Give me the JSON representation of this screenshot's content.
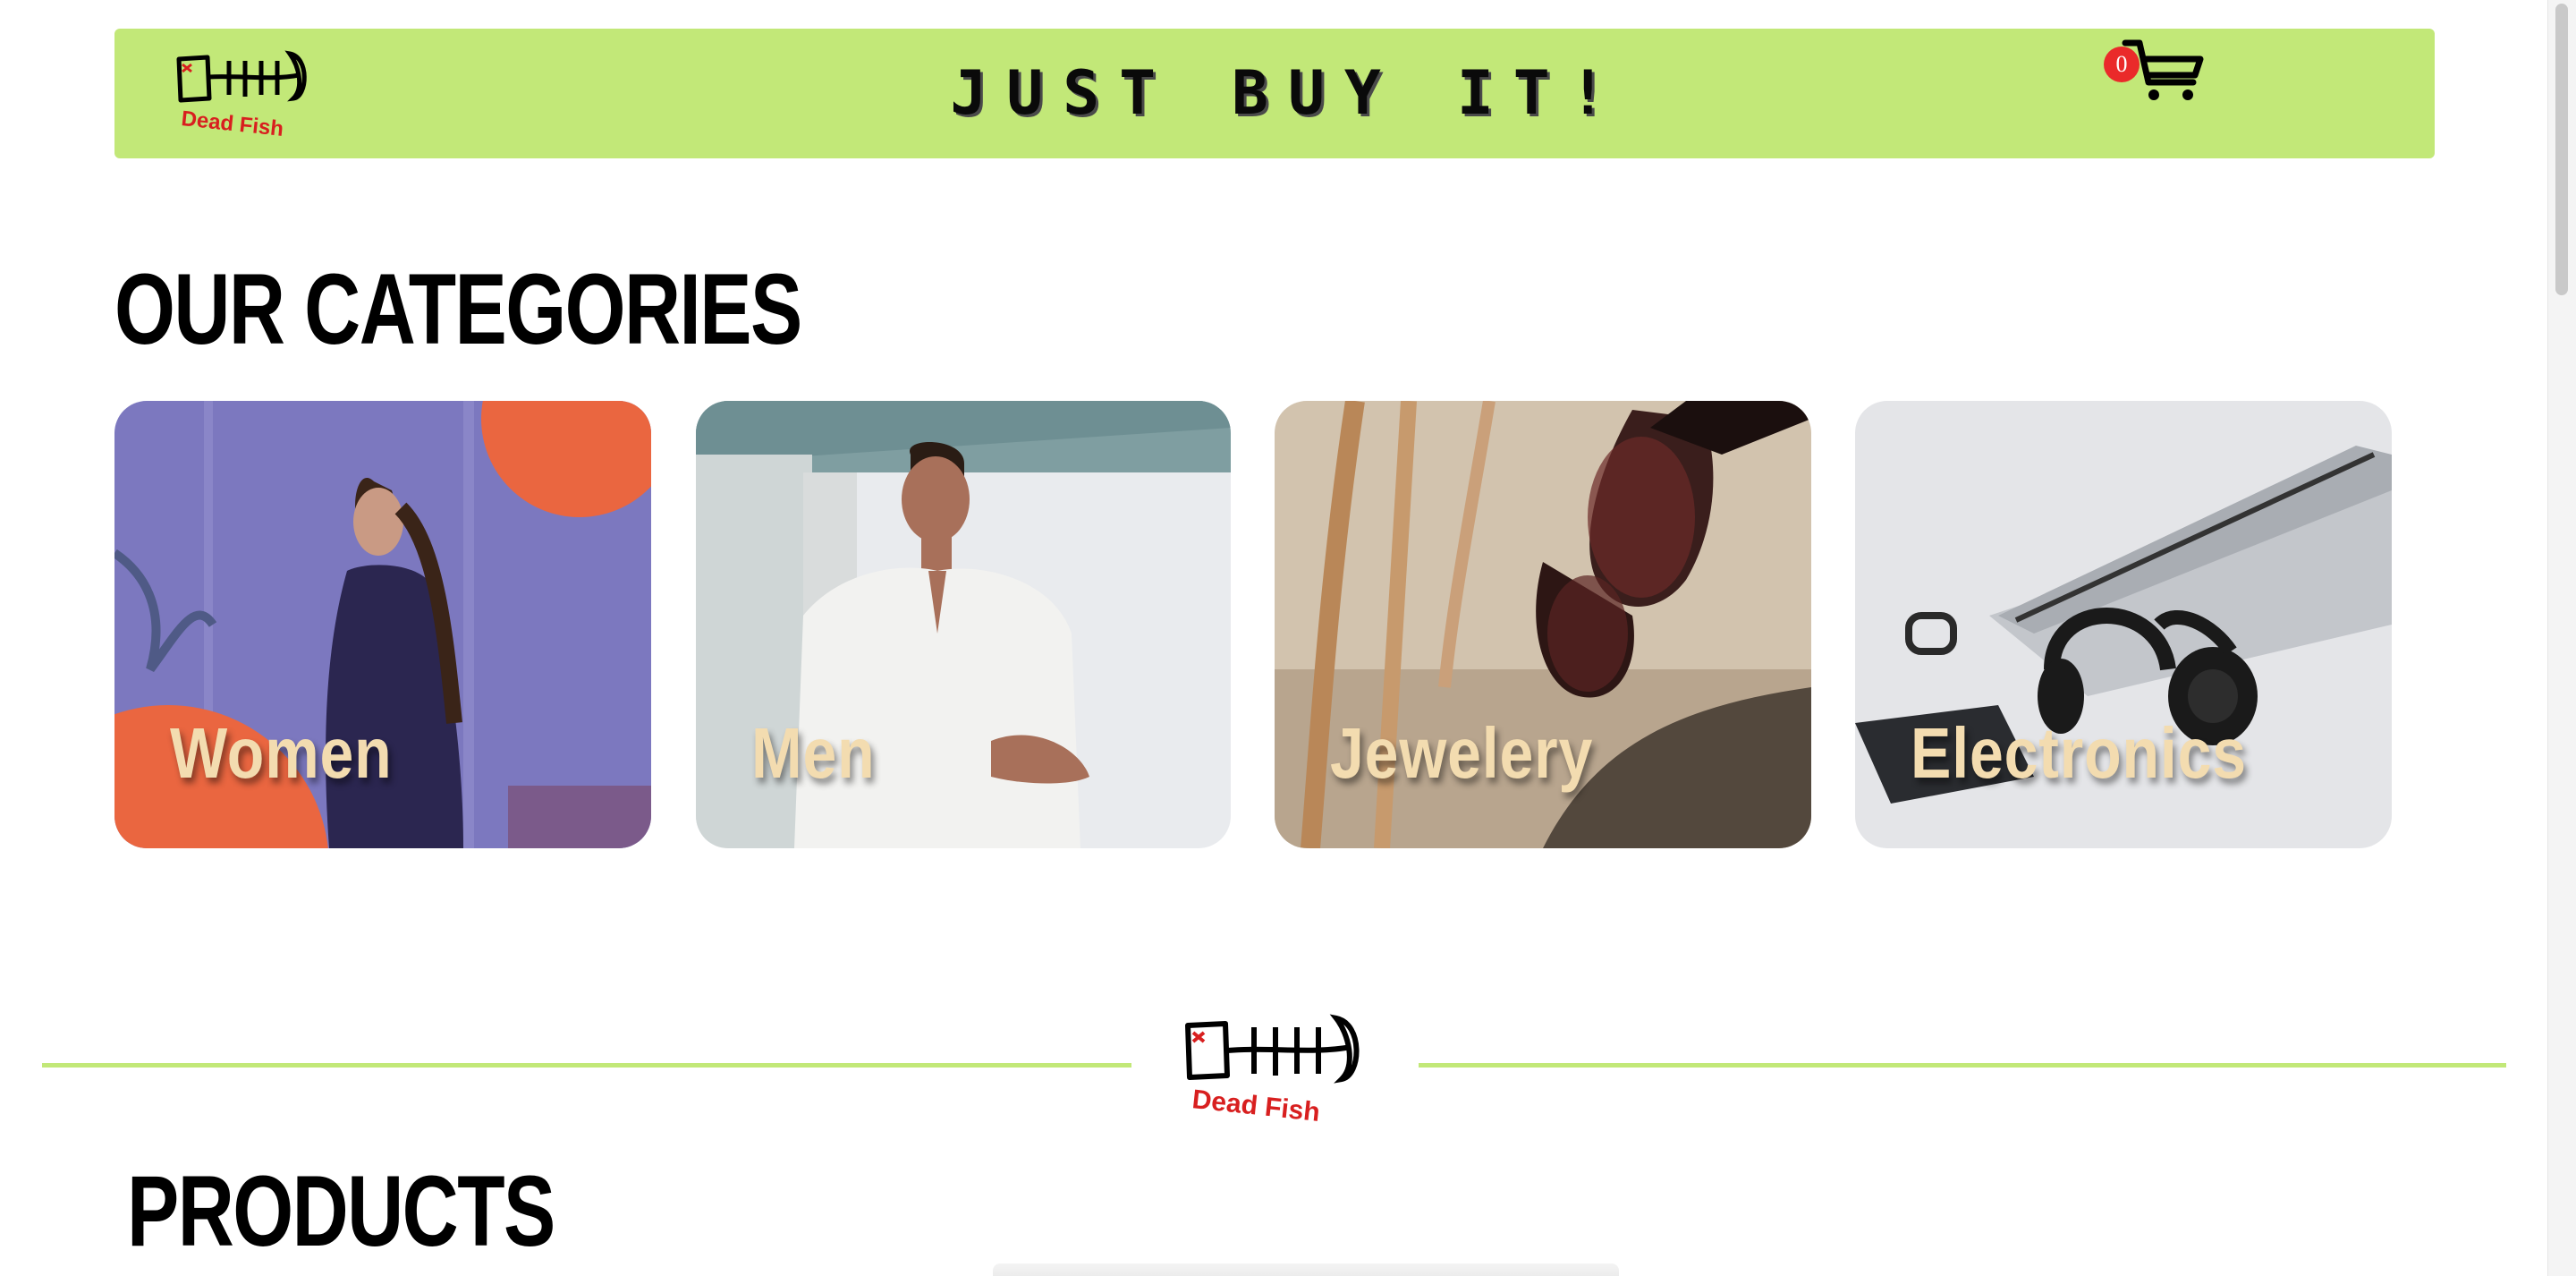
{
  "header": {
    "logo_alt": "Dead Fish",
    "banner_text": "JUST BUY IT!",
    "cart_count": "0",
    "cart_icon": "cart-icon",
    "background_color": "#c2e878"
  },
  "categories": {
    "title": "OUR CATEGORIES",
    "items": [
      {
        "label": "Women"
      },
      {
        "label": "Men"
      },
      {
        "label": "Jewelery"
      },
      {
        "label": "Electronics"
      }
    ]
  },
  "divider": {
    "logo_text": "Dead Fish",
    "line_color": "#c2e878"
  },
  "products": {
    "title": "PRODUCTS"
  },
  "colors": {
    "accent": "#c2e878",
    "badge": "#ea2a2a",
    "card_label": "#f3dcb0"
  }
}
